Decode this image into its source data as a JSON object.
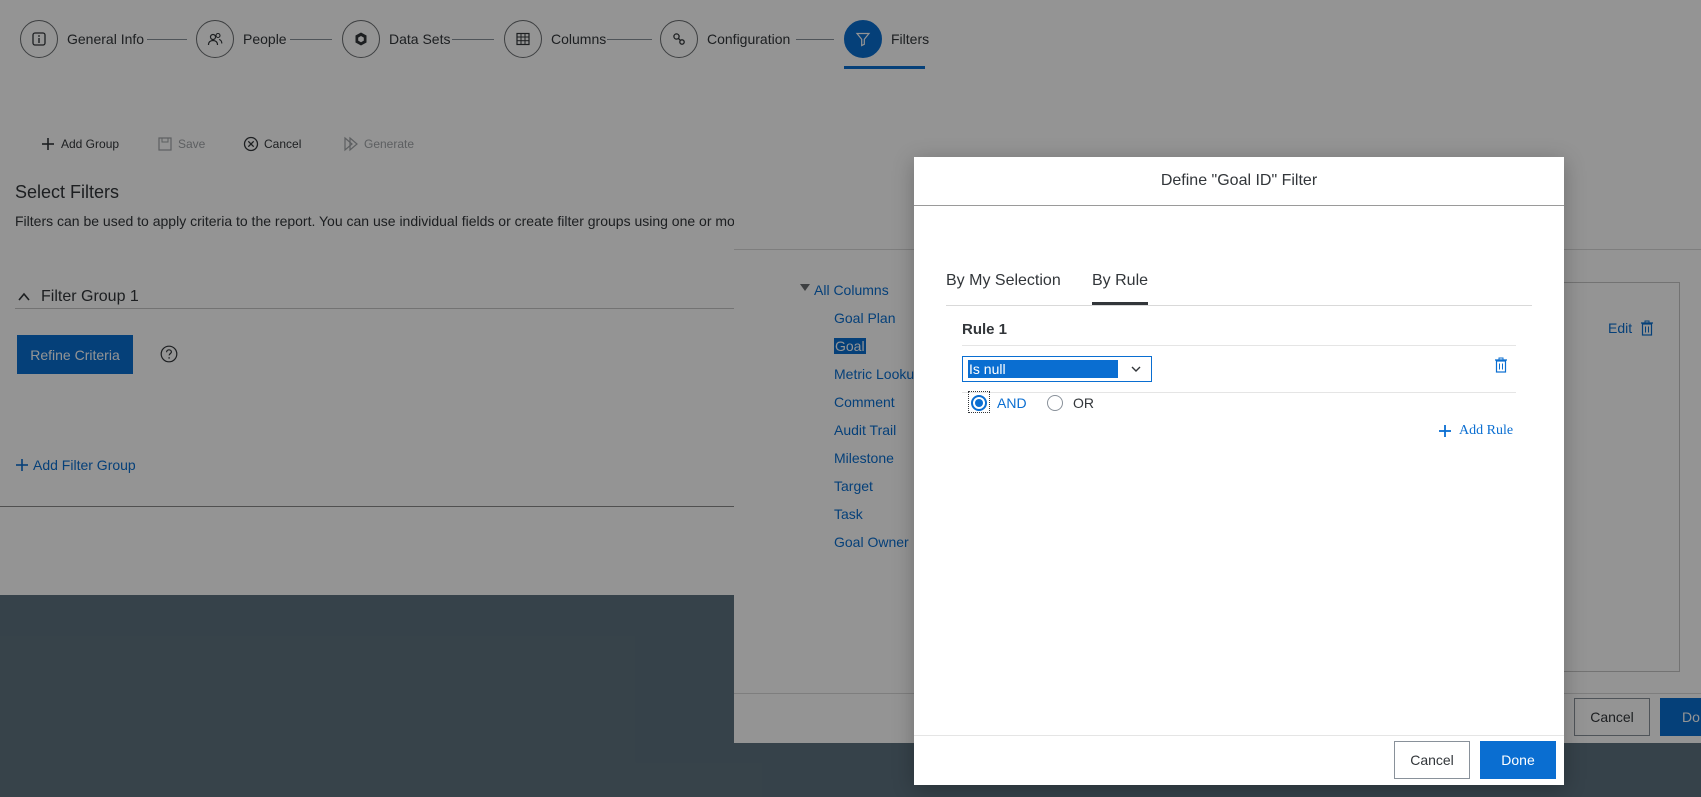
{
  "wizard": {
    "steps": [
      {
        "label": "General Info",
        "icon": "info-icon"
      },
      {
        "label": "People",
        "icon": "people-icon"
      },
      {
        "label": "Data Sets",
        "icon": "dataset-icon"
      },
      {
        "label": "Columns",
        "icon": "grid-icon"
      },
      {
        "label": "Configuration",
        "icon": "configuration-icon"
      },
      {
        "label": "Filters",
        "icon": "filter-icon"
      }
    ],
    "active_step": "Filters"
  },
  "toolbar": {
    "add_group": "Add Group",
    "save": "Save",
    "cancel": "Cancel",
    "generate": "Generate"
  },
  "main": {
    "title": "Select Filters",
    "description": "Filters can be used to apply criteria to the report. You can use individual fields or create filter groups using one or mo",
    "filter_group_title": "Filter Group 1",
    "refine_button": "Refine Criteria",
    "add_filter_group": "Add Filter Group"
  },
  "mid_dialog": {
    "tree_root": "All Columns",
    "tree_items": [
      "Goal Plan",
      "Goal",
      "Metric Looku",
      "Comment",
      "Audit Trail",
      "Milestone",
      "Target",
      "Task",
      "Goal Owner"
    ],
    "selected_item": "Goal",
    "edit_label": "Edit",
    "cancel_label": "Cancel",
    "done_label": "Do"
  },
  "dialog": {
    "title": "Define \"Goal ID\" Filter",
    "tabs": [
      {
        "label": "By My Selection",
        "active": false
      },
      {
        "label": "By Rule",
        "active": true
      }
    ],
    "rule_title": "Rule 1",
    "operator_value": "Is null",
    "logic_options": [
      {
        "label": "AND",
        "checked": true
      },
      {
        "label": "OR",
        "checked": false
      }
    ],
    "add_rule": "Add Rule",
    "cancel_label": "Cancel",
    "done_label": "Done"
  },
  "colors": {
    "accent": "#0a6ed1",
    "text": "#32363a",
    "backdrop": "#5e7380"
  }
}
